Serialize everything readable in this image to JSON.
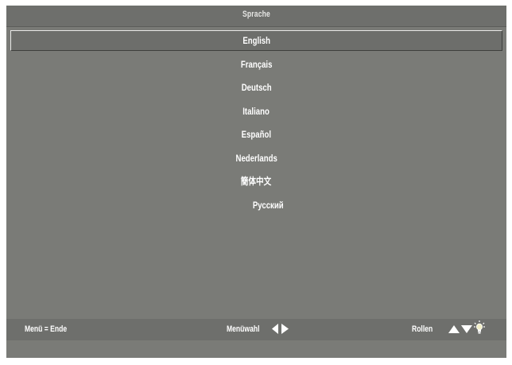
{
  "menu": {
    "title": "Sprache",
    "languages": [
      "English",
      "Français",
      "Deutsch",
      "Italiano",
      "Español",
      "Nederlands",
      "簡体中文",
      "Русский"
    ],
    "selected": "English"
  },
  "footer": {
    "exit_hint": "Menü = Ende",
    "select_hint": "Menüwahl",
    "scroll_hint": "Rollen"
  },
  "icons": {
    "select": [
      "arrow-left-icon",
      "arrow-right-icon"
    ],
    "scroll": [
      "arrow-up-icon",
      "arrow-down-icon",
      "lamp-icon"
    ]
  },
  "colors": {
    "panel": "#7a7b77",
    "bar": "#6e6f6c",
    "text": "#ffffff"
  }
}
